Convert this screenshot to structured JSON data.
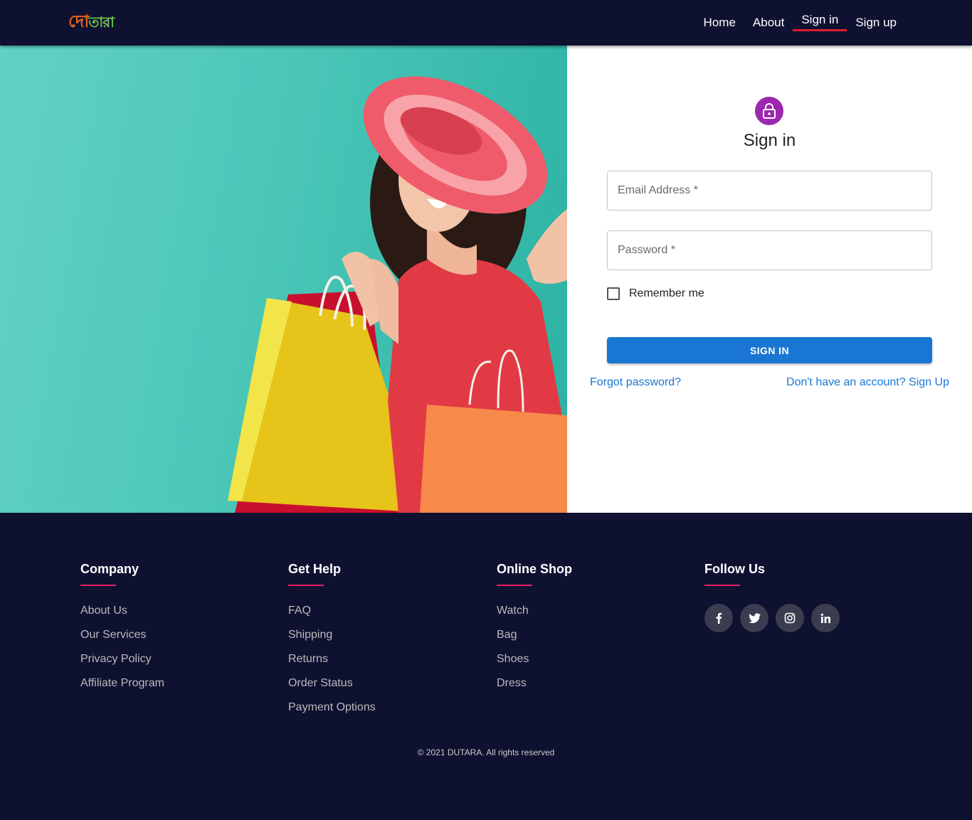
{
  "brand": {
    "logo_part1": "দো",
    "logo_part2": "তারা"
  },
  "nav": {
    "items": [
      "Home",
      "About",
      "Sign in",
      "Sign up"
    ],
    "active": "Sign in"
  },
  "signin": {
    "title": "Sign in",
    "email_placeholder": "Email Address *",
    "password_placeholder": "Password *",
    "remember_label": "Remember me",
    "button_label": "SIGN IN",
    "forgot_link": "Forgot password?",
    "signup_link": "Don't have an account? Sign Up"
  },
  "footer": {
    "columns": [
      {
        "title": "Company",
        "items": [
          "About Us",
          "Our Services",
          "Privacy Policy",
          "Affiliate Program"
        ]
      },
      {
        "title": "Get Help",
        "items": [
          "FAQ",
          "Shipping",
          "Returns",
          "Order Status",
          "Payment Options"
        ]
      },
      {
        "title": "Online Shop",
        "items": [
          "Watch",
          "Bag",
          "Shoes",
          "Dress"
        ]
      }
    ],
    "follow_title": "Follow Us",
    "social": [
      "facebook-icon",
      "twitter-icon",
      "instagram-icon",
      "linkedin-icon"
    ],
    "copyright": "© 2021 DUTARA. All rights reserved"
  },
  "colors": {
    "navy": "#0e1130",
    "accent_blue": "#1976d2",
    "avatar_purple": "#9c27b0",
    "active_underline": "#e21a2c",
    "footer_underline": "#e91e63"
  }
}
